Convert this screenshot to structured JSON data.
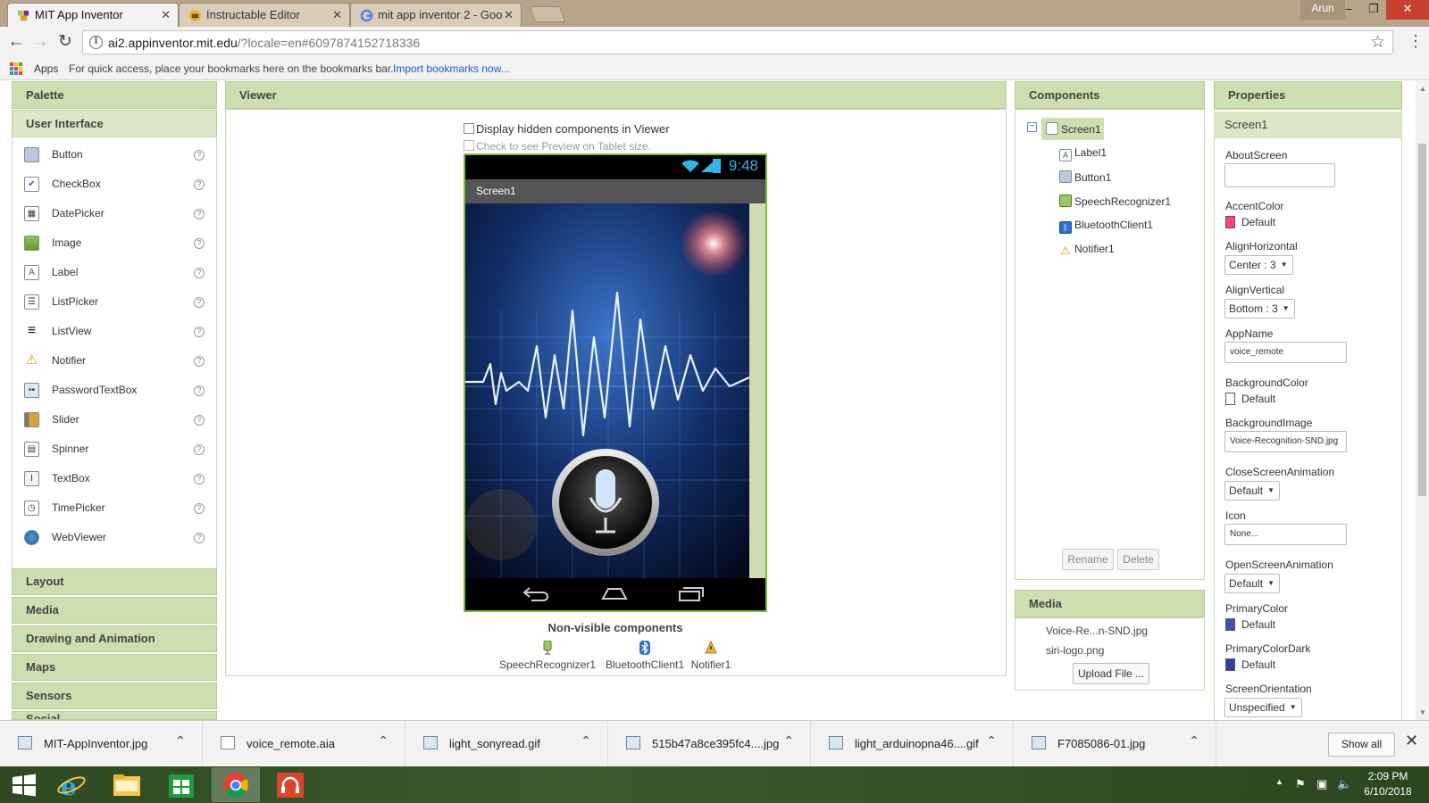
{
  "browser": {
    "tabs": [
      {
        "title": "MIT App Inventor",
        "close": "✕"
      },
      {
        "title": "Instructable Editor",
        "close": "✕"
      },
      {
        "title": "mit app inventor 2 - Goo",
        "close": "✕"
      }
    ],
    "profile_name": "Arun",
    "url_host": "ai2.appinventor.mit.edu",
    "url_path": "/?locale=en#6097874152718336",
    "bookmarks": {
      "apps_label": "Apps",
      "hint": "For quick access, place your bookmarks here on the bookmarks bar.",
      "import_link": "Import bookmarks now..."
    }
  },
  "palette": {
    "title": "Palette",
    "category": "User Interface",
    "items": [
      {
        "label": "Button",
        "icon": "button-icon"
      },
      {
        "label": "CheckBox",
        "icon": "checkbox-icon"
      },
      {
        "label": "DatePicker",
        "icon": "datepicker-icon"
      },
      {
        "label": "Image",
        "icon": "image-icon"
      },
      {
        "label": "Label",
        "icon": "label-icon"
      },
      {
        "label": "ListPicker",
        "icon": "listpicker-icon"
      },
      {
        "label": "ListView",
        "icon": "listview-icon"
      },
      {
        "label": "Notifier",
        "icon": "notifier-icon"
      },
      {
        "label": "PasswordTextBox",
        "icon": "password-icon"
      },
      {
        "label": "Slider",
        "icon": "slider-icon"
      },
      {
        "label": "Spinner",
        "icon": "spinner-icon"
      },
      {
        "label": "TextBox",
        "icon": "textbox-icon"
      },
      {
        "label": "TimePicker",
        "icon": "timepicker-icon"
      },
      {
        "label": "WebViewer",
        "icon": "webviewer-icon"
      }
    ],
    "help_glyph": "?",
    "groups": [
      "Layout",
      "Media",
      "Drawing and Animation",
      "Maps",
      "Sensors",
      "Social"
    ]
  },
  "viewer": {
    "title": "Viewer",
    "display_hidden": "Display hidden components in Viewer",
    "tablet_preview": "Check to see Preview on Tablet size.",
    "phone": {
      "time": "9:48",
      "screen_title": "Screen1"
    },
    "nonvisible_title": "Non-visible components",
    "nonvisible": [
      "SpeechRecognizer1",
      "BluetoothClient1",
      "Notifier1"
    ]
  },
  "components": {
    "title": "Components",
    "collapse_glyph": "−",
    "screen": "Screen1",
    "children": [
      "Label1",
      "Button1",
      "SpeechRecognizer1",
      "BluetoothClient1",
      "Notifier1"
    ],
    "rename_label": "Rename",
    "delete_label": "Delete"
  },
  "media": {
    "title": "Media",
    "files": [
      "Voice-Re...n-SND.jpg",
      "siri-logo.png"
    ],
    "upload_label": "Upload File ..."
  },
  "properties": {
    "title": "Properties",
    "screen": "Screen1",
    "about_screen": "AboutScreen",
    "accent_color": {
      "name": "AccentColor",
      "value": "Default",
      "color": "#ff4081"
    },
    "align_horizontal": {
      "name": "AlignHorizontal",
      "value": "Center : 3"
    },
    "align_vertical": {
      "name": "AlignVertical",
      "value": "Bottom : 3"
    },
    "app_name": {
      "name": "AppName",
      "value": "voice_remote"
    },
    "background_color": {
      "name": "BackgroundColor",
      "value": "Default",
      "color": "#ffffff"
    },
    "background_image": {
      "name": "BackgroundImage",
      "value": "Voice-Recognition-SND.jpg"
    },
    "close_screen_animation": {
      "name": "CloseScreenAnimation",
      "value": "Default"
    },
    "icon": {
      "name": "Icon",
      "value": "None..."
    },
    "open_screen_animation": {
      "name": "OpenScreenAnimation",
      "value": "Default"
    },
    "primary_color": {
      "name": "PrimaryColor",
      "value": "Default",
      "color": "#3f51b5"
    },
    "primary_color_dark": {
      "name": "PrimaryColorDark",
      "value": "Default",
      "color": "#303f9f"
    },
    "screen_orientation": {
      "name": "ScreenOrientation",
      "value": "Unspecified"
    }
  },
  "downloads": {
    "items": [
      "MIT-AppInventor.jpg",
      "voice_remote.aia",
      "light_sonyread.gif",
      "515b47a8ce395fc4....jpg",
      "light_arduinopna46....gif",
      "F7085086-01.jpg"
    ],
    "show_all": "Show all"
  },
  "taskbar": {
    "time": "2:09 PM",
    "date": "6/10/2018"
  },
  "colors": {
    "panel_header": "#cddeb0",
    "android_green": "#7dbb3a",
    "status_blue": "#33b5e5",
    "link_blue": "#1a5fc0"
  }
}
